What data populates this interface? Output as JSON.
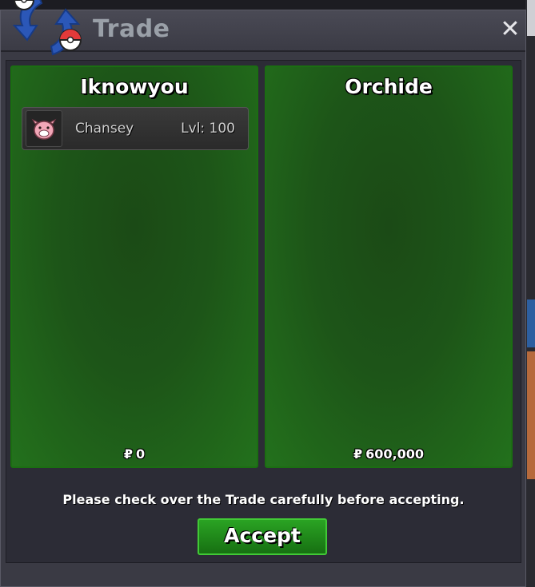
{
  "window": {
    "title": "Trade",
    "close_icon": "close-icon"
  },
  "trade": {
    "left": {
      "player": "Iknowyou",
      "pokemon": [
        {
          "name": "Chansey",
          "level": "Lvl: 100",
          "icon": "chansey-sprite"
        }
      ],
      "money": "0",
      "currency_symbol": "₽"
    },
    "right": {
      "player": "Orchide",
      "pokemon": [],
      "money": "600,000",
      "currency_symbol": "₽"
    }
  },
  "notice": "Please check over the Trade carefully before accepting.",
  "accept_label": "Accept",
  "colors": {
    "panel_green": "#1d5518",
    "panel_border": "#1b6e12",
    "button_green": "#2aa323",
    "title_gray": "#9aa0a8"
  }
}
